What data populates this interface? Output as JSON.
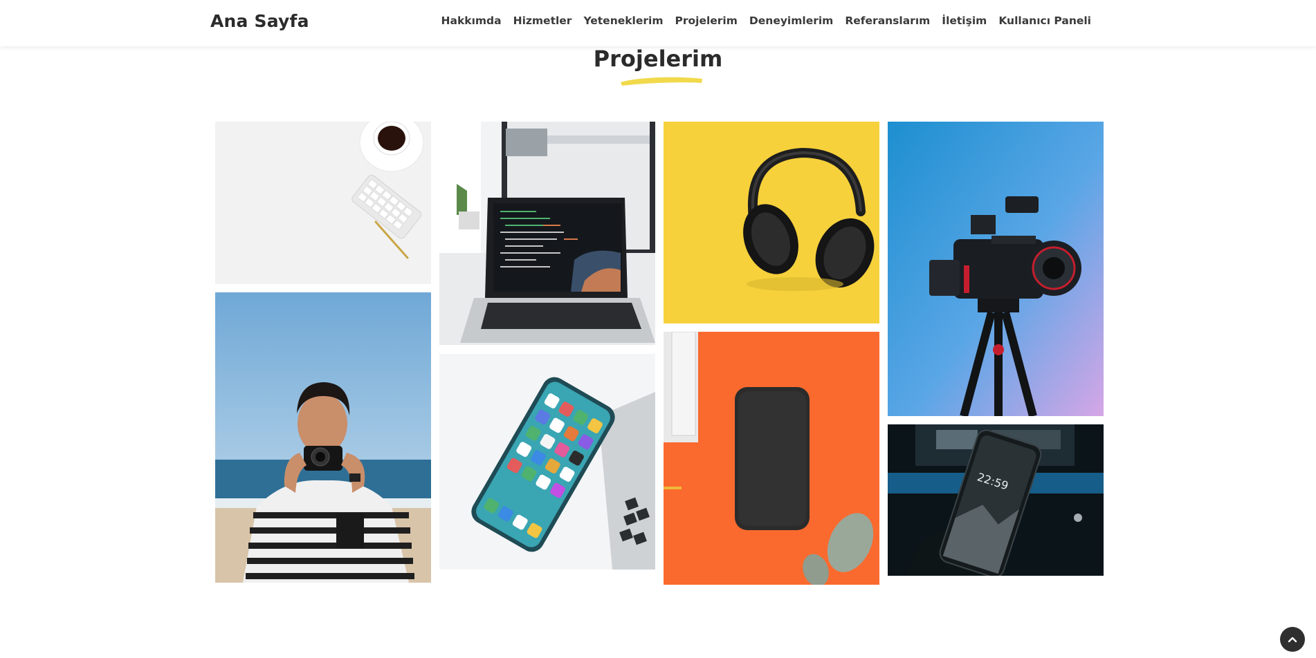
{
  "brand": "Ana Sayfa",
  "nav": [
    "Hakkımda",
    "Hizmetler",
    "Yeteneklerim",
    "Projelerim",
    "Deneyimlerim",
    "Referanslarım",
    "İletişim",
    "Kullanıcı Paneli"
  ],
  "section": {
    "title": "Projelerim",
    "accent_color": "#f1d94b"
  },
  "gallery": [
    {
      "subject": "desk with coffee cup, keyboard and pen"
    },
    {
      "subject": "photographer on the beach"
    },
    {
      "subject": "laptop showing code"
    },
    {
      "subject": "smartphone home screen"
    },
    {
      "subject": "headphones on yellow background"
    },
    {
      "subject": "smartphone on orange background"
    },
    {
      "subject": "camera on tripod in blue light"
    },
    {
      "subject": "phone lock screen"
    }
  ],
  "lock_screen_time": "22:59",
  "icons": {
    "scroll_top": "chevron-up-icon"
  }
}
